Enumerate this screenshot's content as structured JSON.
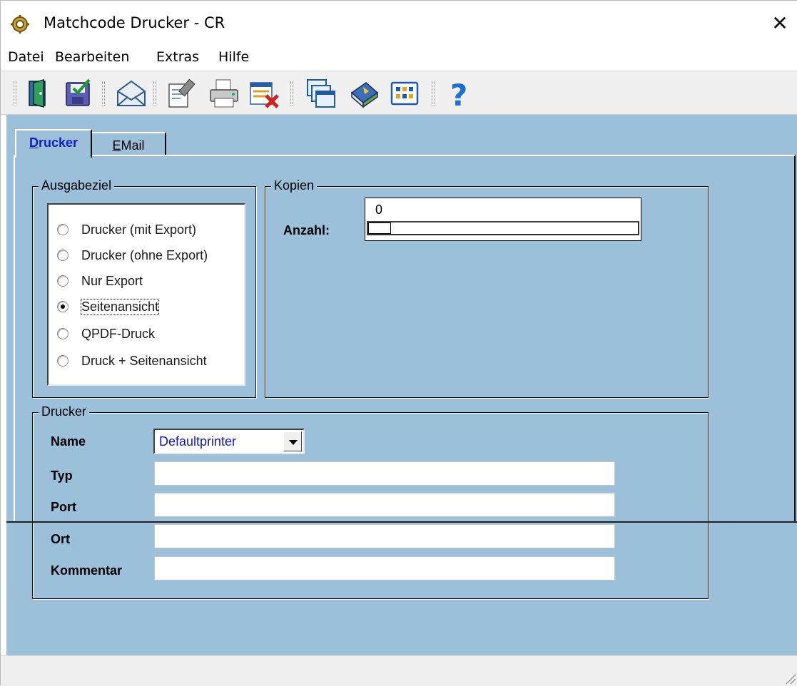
{
  "window": {
    "title": "Matchcode Drucker - CR",
    "close_glyph": "✕",
    "icon": "gear-icon"
  },
  "menu": [
    "Datei",
    "Bearbeiten",
    "Extras",
    "Hilfe"
  ],
  "toolbar": {
    "buttons": [
      "exit-door-icon",
      "save-check-icon",
      "email-envelope-icon",
      "edit-document-icon",
      "printer-icon",
      "delete-list-icon",
      "copy-windows-icon",
      "book-icon",
      "grid-view-icon",
      "help-icon"
    ]
  },
  "tabs": [
    {
      "label_mnemonic": "D",
      "label_rest": "rucker",
      "active": true
    },
    {
      "label_mnemonic": "E",
      "label_rest": "Mail",
      "active": false
    }
  ],
  "ausgabeziel": {
    "legend": "Ausgabeziel",
    "options": [
      "Drucker (mit Export)",
      "Drucker (ohne Export)",
      "Nur Export",
      "Seitenansicht",
      "QPDF-Druck",
      "Druck + Seitenansicht"
    ],
    "selected": "Seitenansicht"
  },
  "kopien": {
    "legend": "Kopien",
    "label": "Anzahl:",
    "value": "0"
  },
  "drucker": {
    "legend": "Drucker",
    "name_label": "Name",
    "name_value": "Defaultprinter",
    "typ_label": "Typ",
    "typ_value": "",
    "port_label": "Port",
    "port_value": "",
    "ort_label": "Ort",
    "ort_value": "",
    "kommentar_label": "Kommentar",
    "kommentar_value": ""
  },
  "colors": {
    "panel_bg": "#9cc0d9",
    "combo_text": "#1416b8",
    "active_tab_text": "#1020c0"
  }
}
